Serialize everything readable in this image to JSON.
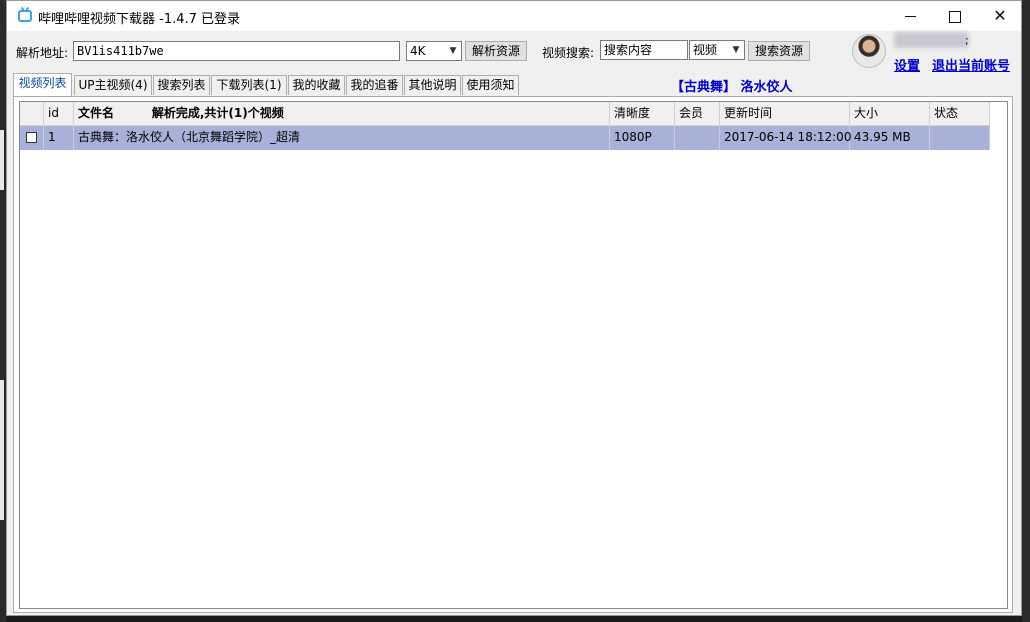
{
  "window": {
    "title": "哔哩哔哩视频下载器 -1.4.7  已登录"
  },
  "parse": {
    "label": "解析地址:",
    "url_value": "BV1is411b7we",
    "quality_selected": "4K",
    "parse_button": "解析资源"
  },
  "search": {
    "label": "视频搜索:",
    "query_value": "搜索内容",
    "type_selected": "视频",
    "search_button": "搜索资源"
  },
  "account": {
    "settings_link": "设置",
    "logout_link": "退出当前账号",
    "name_suffix": ";"
  },
  "tabs": [
    {
      "label": "视频列表",
      "active": true
    },
    {
      "label": "UP主视频(4)"
    },
    {
      "label": "搜索列表"
    },
    {
      "label": "下载列表(1)"
    },
    {
      "label": "我的收藏"
    },
    {
      "label": "我的追番"
    },
    {
      "label": "其他说明"
    },
    {
      "label": "使用须知"
    }
  ],
  "current_video_title": "【古典舞】 洛水佼人",
  "table": {
    "columns": [
      "",
      "id",
      "文件名",
      "清晰度",
      "会员",
      "更新时间",
      "大小",
      "状态"
    ],
    "status_text": "解析完成,共计(1)个视频",
    "rows": [
      {
        "checked": false,
        "id": "1",
        "filename": "古典舞：洛水佼人（北京舞蹈学院）_超清",
        "quality": "1080P",
        "vip": "",
        "updated": "2017-06-14 18:12:00",
        "size": "43.95 MB",
        "status": ""
      }
    ]
  },
  "colors": {
    "selected_row": "#a8b1d8",
    "link": "#0000cc",
    "title_icon": "#3aa0e8"
  }
}
